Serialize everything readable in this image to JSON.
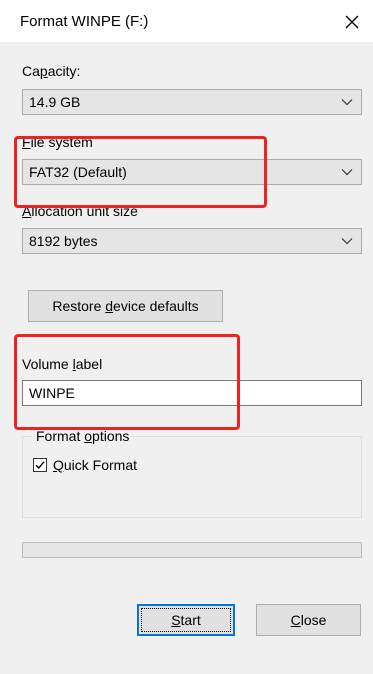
{
  "window": {
    "title": "Format WINPE (F:)"
  },
  "capacity": {
    "label_mnemonic": "p",
    "label_pre": "Ca",
    "label_post": "acity:",
    "value": "14.9 GB"
  },
  "file_system": {
    "label_mnemonic": "F",
    "label_rest": "ile system",
    "value": "FAT32 (Default)"
  },
  "allocation": {
    "label_mnemonic": "A",
    "label_rest": "llocation unit size",
    "value": "8192 bytes"
  },
  "restore_button": {
    "label_pre": "Restore ",
    "label_mnemonic": "d",
    "label_post": "evice defaults"
  },
  "volume_label": {
    "label_pre": "Volume ",
    "label_mnemonic": "l",
    "label_post": "abel",
    "value": "WINPE"
  },
  "format_options": {
    "title_pre": "Format ",
    "title_mnemonic": "o",
    "title_post": "ptions",
    "quick_format": {
      "label_mnemonic": "Q",
      "label_rest": "uick Format",
      "checked": true
    }
  },
  "progress": {
    "fraction": 0
  },
  "buttons": {
    "start_mnemonic": "S",
    "start_rest": "tart",
    "close_mnemonic": "C",
    "close_rest": "lose"
  },
  "colors": {
    "annotation": "#ee2222",
    "focus_border": "#0078d7",
    "dialog_bg": "#f0f0f0"
  },
  "icons": {
    "close": "close-icon",
    "dropdown": "chevron-down-icon",
    "check": "checkmark-icon"
  }
}
